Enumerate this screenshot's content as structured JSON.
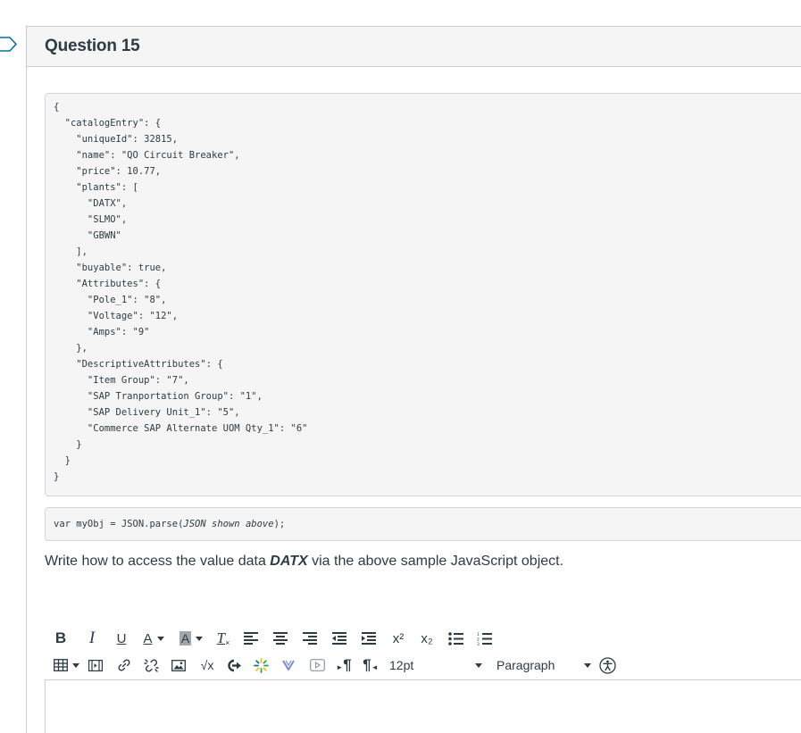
{
  "question": {
    "title": "Question 15"
  },
  "json_code": "{\n  \"catalogEntry\": {\n    \"uniqueId\": 32815,\n    \"name\": \"QO Circuit Breaker\",\n    \"price\": 10.77,\n    \"plants\": [\n      \"DATX\",\n      \"SLMO\",\n      \"GBWN\"\n    ],\n    \"buyable\": true,\n    \"Attributes\": {\n      \"Pole_1\": \"8\",\n      \"Voltage\": \"12\",\n      \"Amps\": \"9\"\n    },\n    \"DescriptiveAttributes\": {\n      \"Item Group\": \"7\",\n      \"SAP Tranportation Group\": \"1\",\n      \"SAP Delivery Unit_1\": \"5\",\n      \"Commerce SAP Alternate UOM Qty_1\": \"6\"\n    }\n  }\n}",
  "parse_line": {
    "prefix": "var myObj = JSON.parse(",
    "italic": "JSON shown above",
    "suffix": ");"
  },
  "prompt": {
    "before": "Write how to access the value data ",
    "emphasis": "DATX",
    "after": " via the above sample JavaScript object."
  },
  "toolbar": {
    "bold": "B",
    "italic": "I",
    "underline": "U",
    "font_color": "A",
    "bg_color": "A",
    "clear_format": "T",
    "superscript": "x²",
    "subscript": "x₂",
    "ltr": "¶",
    "rtl": "¶",
    "font_size": "12pt",
    "block_format": "Paragraph"
  },
  "icons": {
    "flag": "flag-icon",
    "accessibility": "accessibility-icon"
  },
  "colors": {
    "text": "#2d3b45",
    "header_bg": "#f5f5f5",
    "border": "#c7cdd1",
    "accent_blue": "#0770a3",
    "accent_green": "#2fa34b",
    "accent_yellow": "#f2c300"
  }
}
